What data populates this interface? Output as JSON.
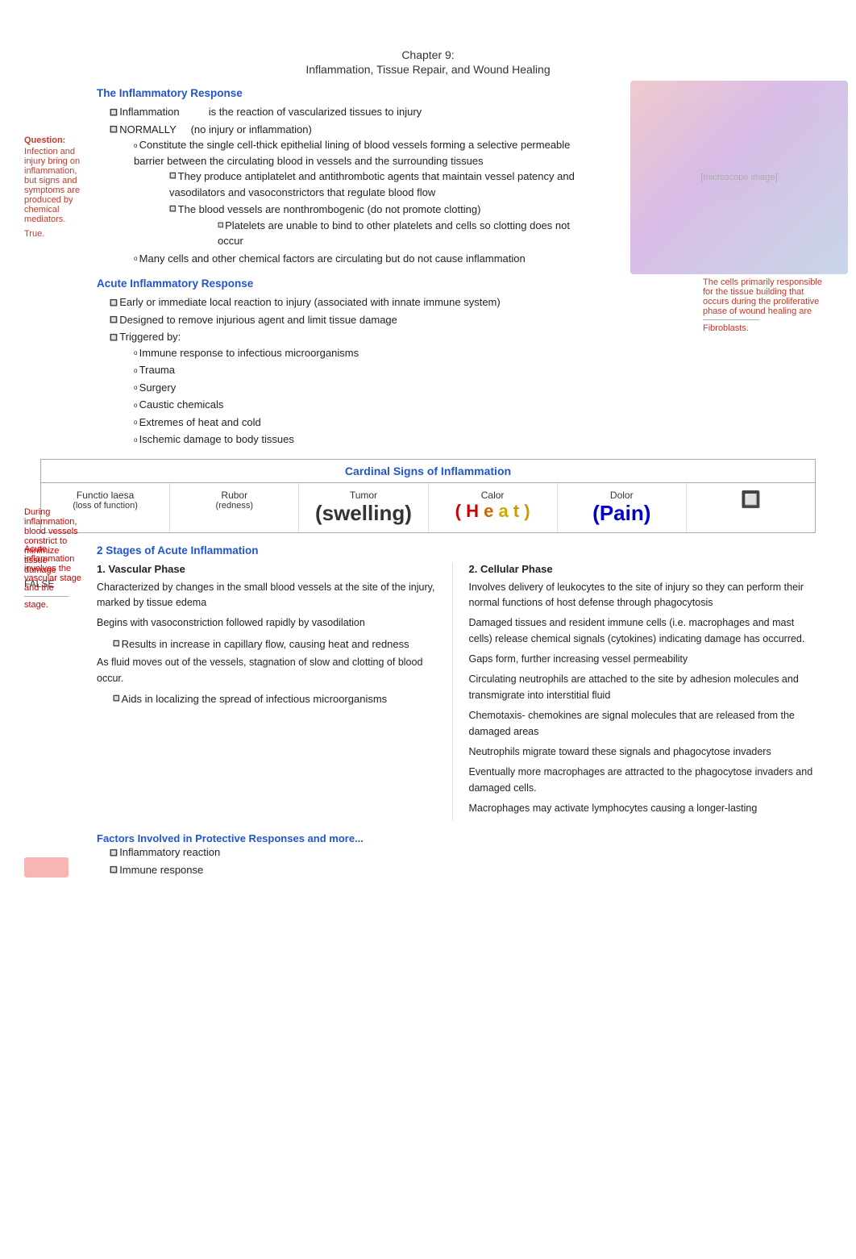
{
  "chapter": {
    "line1": "Chapter 9:",
    "line2": "Inflammation, Tissue Repair, and Wound Healing"
  },
  "inflammatory_response": {
    "heading": "The Inflammatory Response",
    "bullets": [
      {
        "text": "Inflammation        is the reaction of vascularized tissues to injury",
        "sub": []
      },
      {
        "text": "NORMALLY    (no injury or inflammation)",
        "sub": [
          {
            "text": "Constitute the single cell-thick epithelial lining of blood vessels forming a selective permeable barrier between the circulating blood in vessels and the surrounding tissues",
            "sub": [
              {
                "text": "They produce antiplatelet and antithrombotic agents that maintain vessel patency and vasodilators and vasoconstrictors that regulate blood flow",
                "sub": []
              },
              {
                "text": "The blood vessels are nonthrombogenic (do not promote clotting)",
                "sub": [
                  "Platelets are unable to bind to other platelets and cells so clotting does not occur"
                ]
              }
            ]
          },
          {
            "text": "Many cells and other chemical factors are circulating but do not cause inflammation",
            "sub": []
          }
        ]
      }
    ]
  },
  "sidebar_question": {
    "label": "Question:",
    "text": "Infection and injury bring on inflammation, but signs and symptoms are produced by chemical mediators.",
    "answer": "True."
  },
  "acute_inflammatory": {
    "heading": "Acute Inflammatory Response",
    "bullets": [
      "Early or immediate local reaction to injury (associated with innate immune system)",
      "Designed to remove injurious agent and limit tissue damage",
      "Triggered by:"
    ],
    "triggered_sub": [
      "Immune response to infectious microorganisms",
      "Trauma",
      "Surgery",
      "Caustic chemicals",
      "Extremes of heat and cold",
      "Ischemic damage to body tissues"
    ]
  },
  "sidebar_right_fibroblasts": {
    "text": "The cells primarily responsible for the tissue building that occurs during the proliferative phase of wound healing are",
    "blank": "___________",
    "answer": "Fibroblasts."
  },
  "cardinal_signs": {
    "heading": "Cardinal Signs of Inflammation",
    "signs": [
      {
        "latin": "Functio laesa",
        "english": "(loss of function)",
        "display": "",
        "color": "dark"
      },
      {
        "latin": "Rubor",
        "english": "(redness)",
        "display": "",
        "color": "red"
      },
      {
        "latin": "Tumor",
        "english": "",
        "display": "(swelling)",
        "color": "dark",
        "size": "big"
      },
      {
        "latin": "Calor",
        "english": "",
        "display": "( H e a t )",
        "color": "yellow",
        "size": "heat"
      },
      {
        "latin": "Dolor",
        "english": "",
        "display": "(Pain)",
        "color": "blue",
        "size": "pain"
      },
      {
        "latin": "",
        "english": "",
        "display": "🔲",
        "color": "dark",
        "size": "icon"
      }
    ]
  },
  "sidebar_during": {
    "text": "During inflammation, blood vessels constrict to minimize tissue damage",
    "answer": "FALSE",
    "text2": "Acute inflammation involves the vascular stage and the",
    "blank": "___________",
    "answer2": "stage."
  },
  "stages": {
    "heading": "2 Stages of Acute Inflammation",
    "stage1": {
      "num": "1.    Vascular Phase",
      "paragraphs": [
        "Characterized by changes in the small blood vessels at the site of the injury, marked by tissue edema",
        "Begins with vasoconstriction followed rapidly by vasodilation",
        "As fluid moves out of the vessels, stagnation of slow and clotting of blood occur."
      ],
      "sub_bullets": [
        "Results in increase in capillary flow, causing heat and redness",
        "Aids in localizing the spread of infectious microorganisms"
      ]
    },
    "stage2": {
      "num": "2.    Cellular Phase",
      "paragraphs": [
        "Involves delivery of leukocytes to the site of injury so they can perform their normal functions of host defense through phagocytosis",
        "Damaged tissues and resident immune cells (i.e. macrophages and mast cells) release chemical signals (cytokines) indicating damage has occurred.",
        "Gaps form, further increasing vessel permeability",
        "Circulating neutrophils are attached to the site by adhesion molecules and transmigrate into interstitial fluid",
        "Chemotaxis- chemokines are signal molecules that are released from the damaged areas",
        "Neutrophils migrate toward these signals and phagocytose invaders",
        "Eventually more macrophages are attracted to the phagocytose invaders and damaged cells.",
        "Macrophages may activate lymphocytes causing a longer-lasting"
      ]
    }
  },
  "factors": {
    "heading": "Factors Involved in Protective Responses and",
    "more": "more...",
    "bullets": [
      "Inflammatory reaction",
      "Immune response"
    ]
  }
}
